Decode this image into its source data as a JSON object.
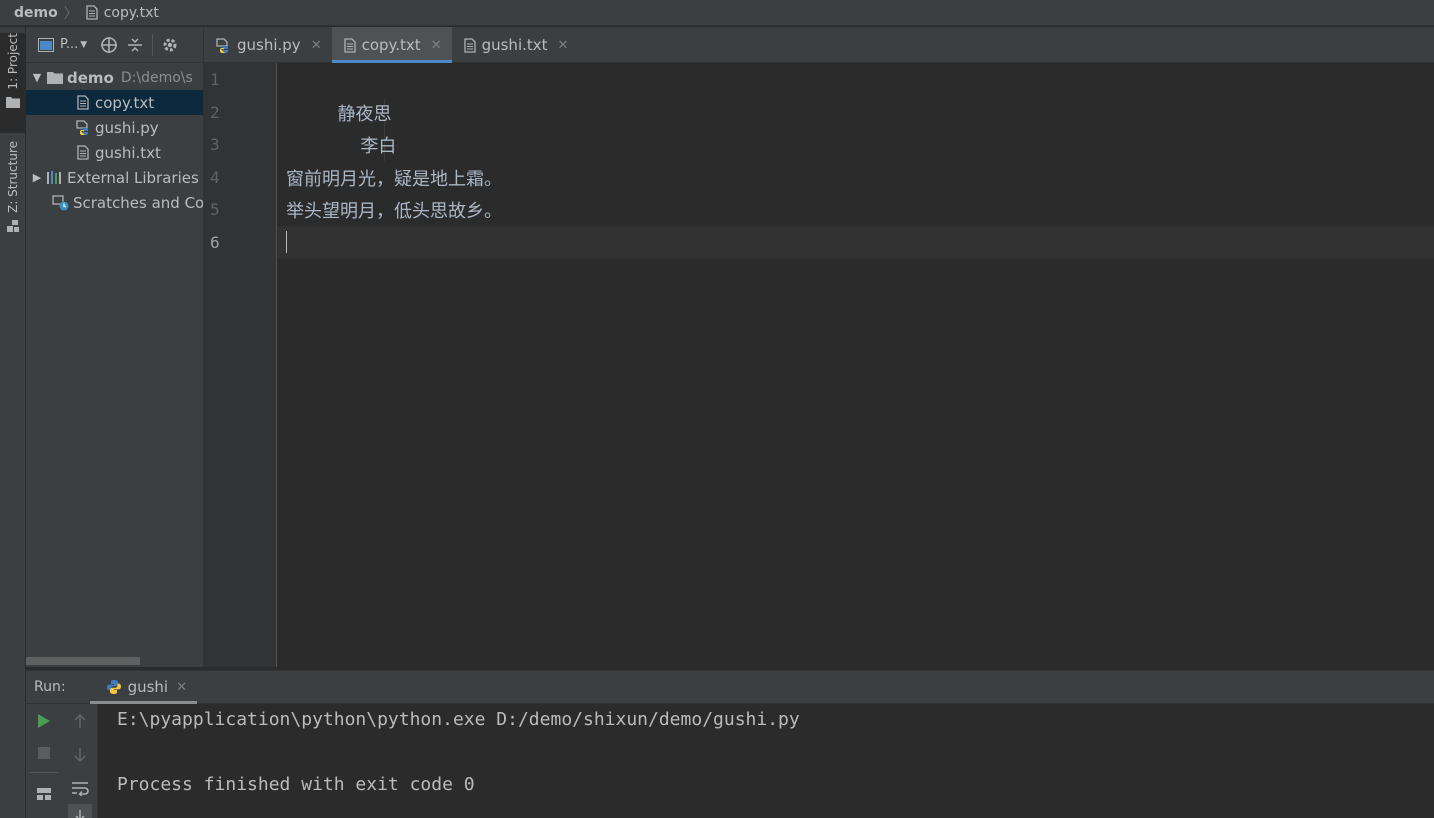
{
  "breadcrumb": {
    "project": "demo",
    "file": "copy.txt"
  },
  "tool_stripe": {
    "project_label": "1: Project",
    "structure_label": "Z: Structure"
  },
  "project_panel": {
    "view_label": "P...",
    "tree": [
      {
        "label": "demo",
        "path": "D:\\demo\\s",
        "type": "folder"
      },
      {
        "label": "copy.txt",
        "type": "text-file",
        "selected": true
      },
      {
        "label": "gushi.py",
        "type": "python-file"
      },
      {
        "label": "gushi.txt",
        "type": "text-file"
      },
      {
        "label": "External Libraries",
        "type": "libraries"
      },
      {
        "label": "Scratches and Cor",
        "type": "scratches"
      }
    ]
  },
  "tabs": [
    {
      "label": "gushi.py",
      "icon": "python-file-icon",
      "active": false
    },
    {
      "label": "copy.txt",
      "icon": "text-file-icon",
      "active": true
    },
    {
      "label": "gushi.txt",
      "icon": "text-file-icon",
      "active": false
    }
  ],
  "editor": {
    "line_numbers": [
      "1",
      "2",
      "3",
      "4",
      "5",
      "6"
    ],
    "current_line": "6",
    "lines": [
      "",
      "         静夜思",
      "             李白",
      "窗前明月光，疑是地上霜。",
      "举头望明月，低头思故乡。",
      ""
    ]
  },
  "run_panel": {
    "label": "Run:",
    "tab_label": "gushi",
    "output": [
      "E:\\pyapplication\\python\\python.exe D:/demo/shixun/demo/gushi.py",
      "",
      "Process finished with exit code 0"
    ]
  },
  "colors": {
    "accent": "#4a88c7",
    "run_green": "#499c54",
    "python_blue": "#3f7cbf",
    "python_yellow": "#f4c63d"
  }
}
